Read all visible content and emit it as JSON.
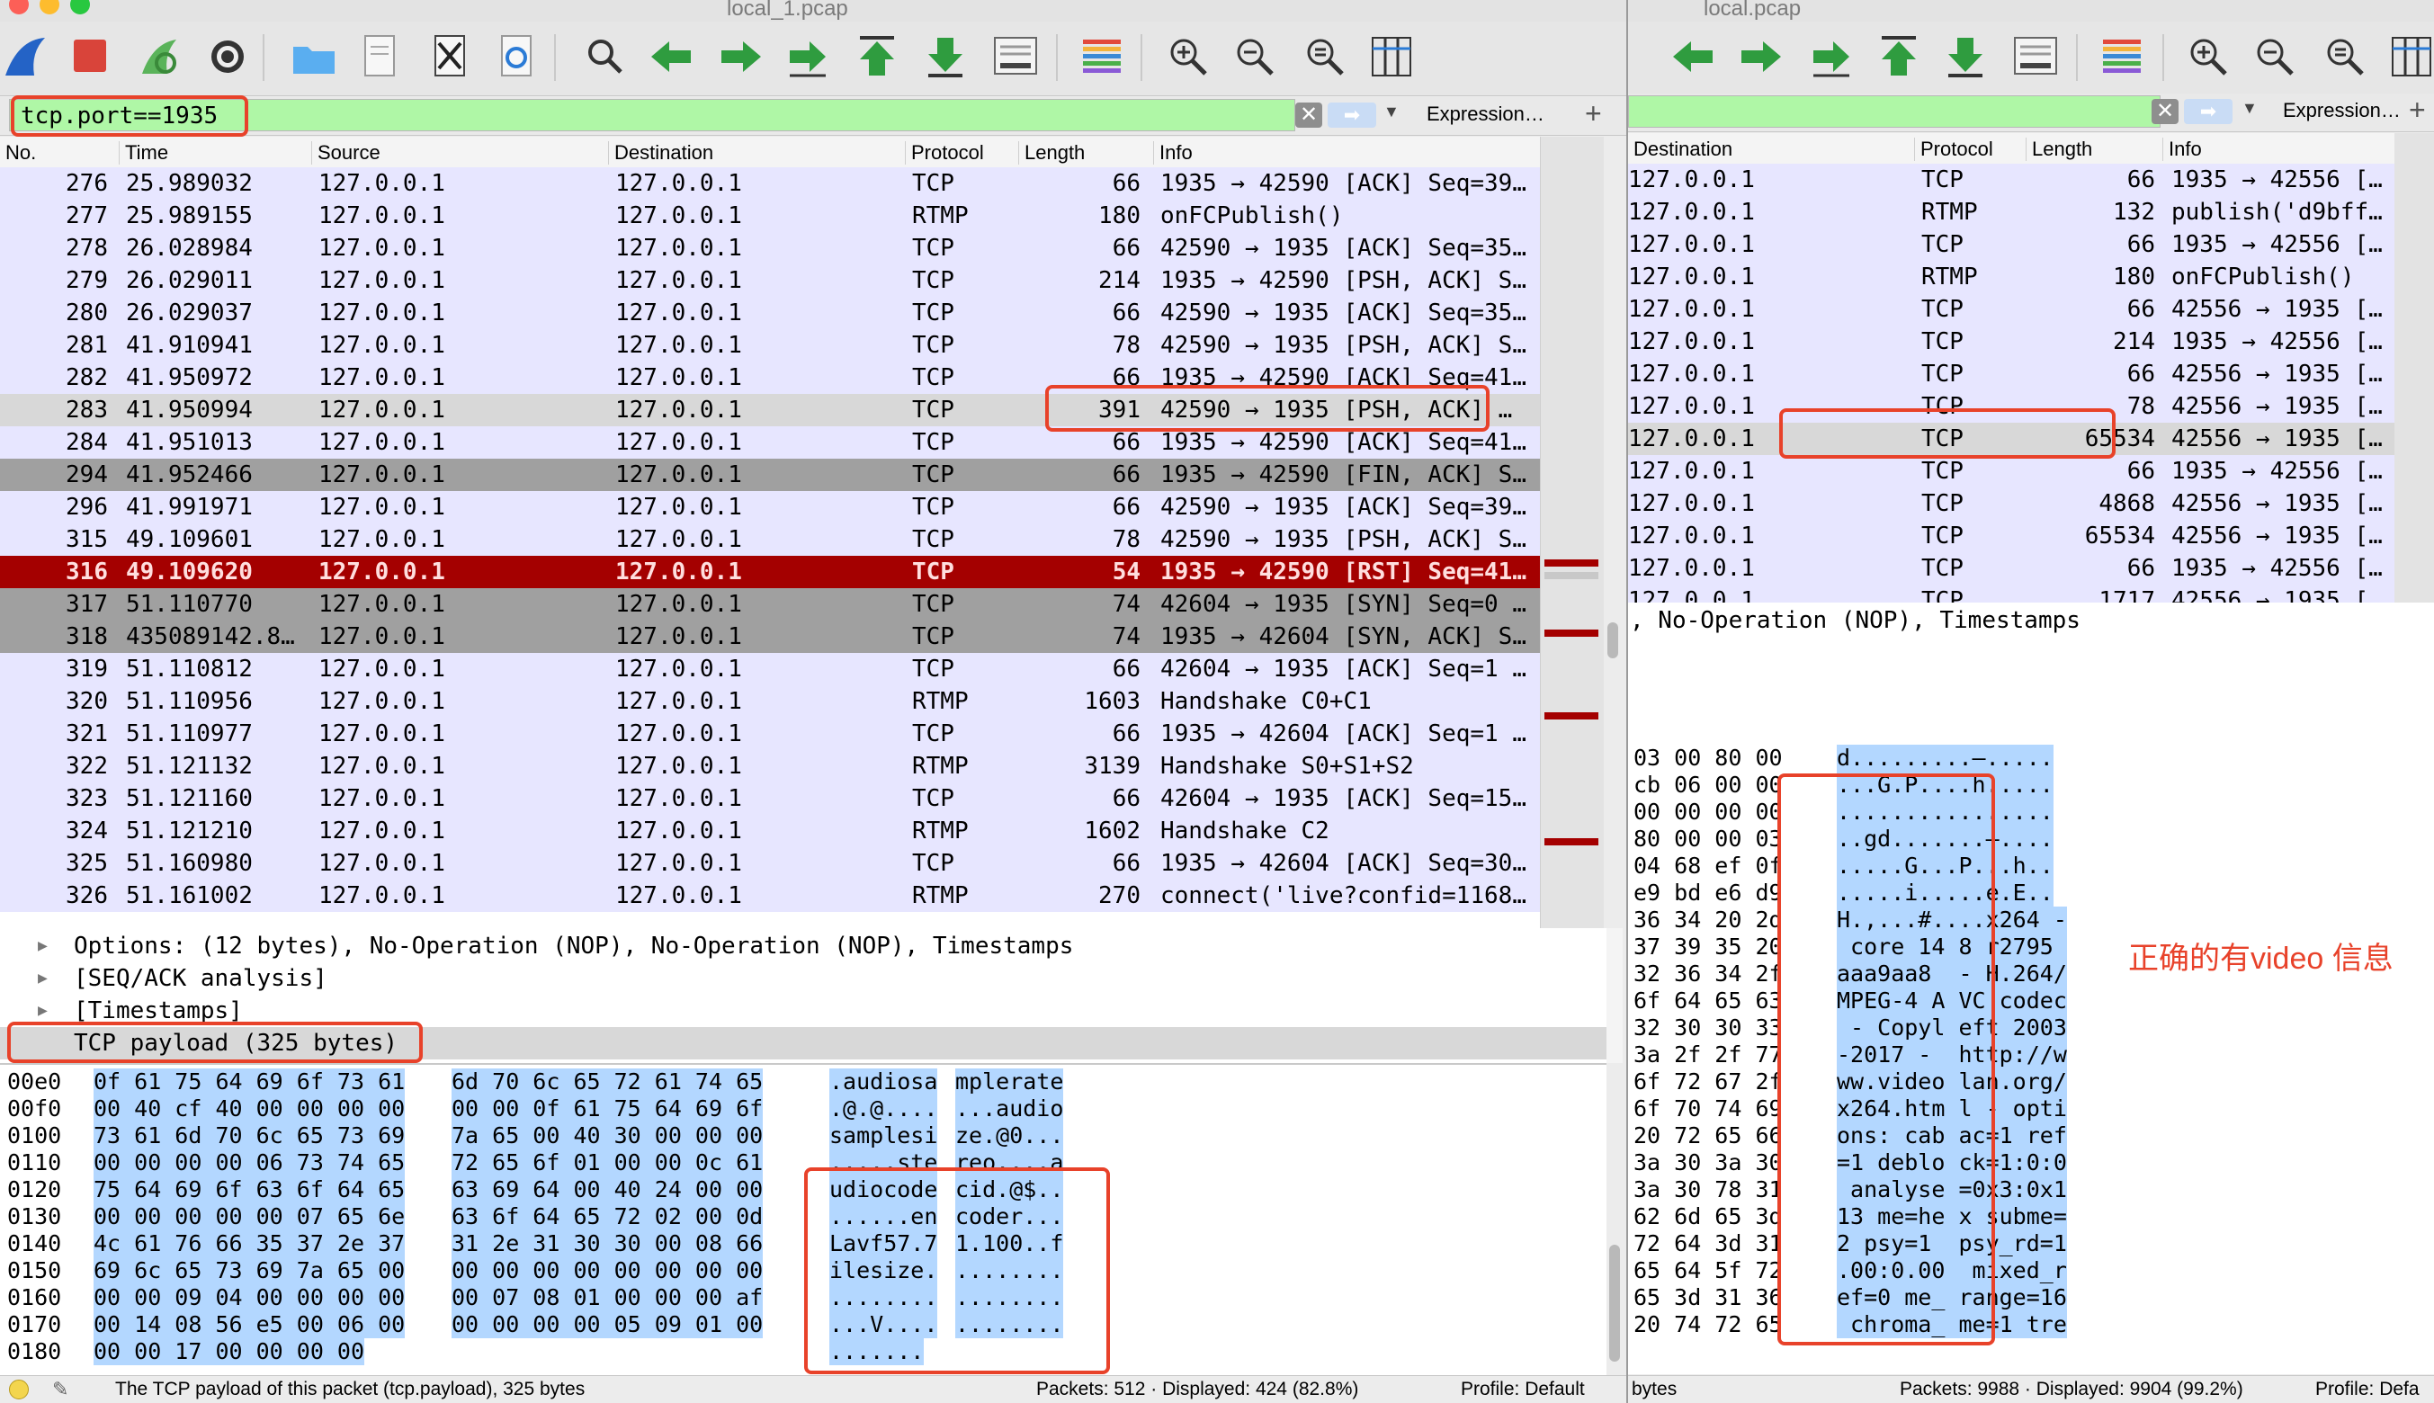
{
  "colors": {
    "filter_bg": "#aff7a6",
    "row_default": "#e7e6ff",
    "row_selected": "#d8d8d8",
    "row_gray": "#a0a0a0",
    "row_rst": "#a40000",
    "hex_selection": "#b3d7ff",
    "callout": "#e8422a"
  },
  "left": {
    "title": "local_1.pcap",
    "filter": {
      "value": "tcp.port==1935",
      "expression_label": "Expression…",
      "plus_label": "+"
    },
    "columns": [
      "No.",
      "Time",
      "Source",
      "Destination",
      "Protocol",
      "Length",
      "Info"
    ],
    "rows": [
      {
        "no": "276",
        "time": "25.989032",
        "src": "127.0.0.1",
        "dst": "127.0.0.1",
        "proto": "TCP",
        "len": "66",
        "info": "1935 → 42590 [ACK] Seq=39…",
        "style": "default"
      },
      {
        "no": "277",
        "time": "25.989155",
        "src": "127.0.0.1",
        "dst": "127.0.0.1",
        "proto": "RTMP",
        "len": "180",
        "info": "onFCPublish()",
        "style": "default"
      },
      {
        "no": "278",
        "time": "26.028984",
        "src": "127.0.0.1",
        "dst": "127.0.0.1",
        "proto": "TCP",
        "len": "66",
        "info": "42590 → 1935 [ACK] Seq=35…",
        "style": "default"
      },
      {
        "no": "279",
        "time": "26.029011",
        "src": "127.0.0.1",
        "dst": "127.0.0.1",
        "proto": "TCP",
        "len": "214",
        "info": "1935 → 42590 [PSH, ACK] S…",
        "style": "default"
      },
      {
        "no": "280",
        "time": "26.029037",
        "src": "127.0.0.1",
        "dst": "127.0.0.1",
        "proto": "TCP",
        "len": "66",
        "info": "42590 → 1935 [ACK] Seq=35…",
        "style": "default"
      },
      {
        "no": "281",
        "time": "41.910941",
        "src": "127.0.0.1",
        "dst": "127.0.0.1",
        "proto": "TCP",
        "len": "78",
        "info": "42590 → 1935 [PSH, ACK] S…",
        "style": "default"
      },
      {
        "no": "282",
        "time": "41.950972",
        "src": "127.0.0.1",
        "dst": "127.0.0.1",
        "proto": "TCP",
        "len": "66",
        "info": "1935 → 42590 [ACK] Seq=41…",
        "style": "default"
      },
      {
        "no": "283",
        "time": "41.950994",
        "src": "127.0.0.1",
        "dst": "127.0.0.1",
        "proto": "TCP",
        "len": "391",
        "info": "42590 → 1935 [PSH, ACK] …",
        "style": "selected"
      },
      {
        "no": "284",
        "time": "41.951013",
        "src": "127.0.0.1",
        "dst": "127.0.0.1",
        "proto": "TCP",
        "len": "66",
        "info": "1935 → 42590 [ACK] Seq=41…",
        "style": "default"
      },
      {
        "no": "294",
        "time": "41.952466",
        "src": "127.0.0.1",
        "dst": "127.0.0.1",
        "proto": "TCP",
        "len": "66",
        "info": "1935 → 42590 [FIN, ACK] S…",
        "style": "gray"
      },
      {
        "no": "296",
        "time": "41.991971",
        "src": "127.0.0.1",
        "dst": "127.0.0.1",
        "proto": "TCP",
        "len": "66",
        "info": "42590 → 1935 [ACK] Seq=39…",
        "style": "default"
      },
      {
        "no": "315",
        "time": "49.109601",
        "src": "127.0.0.1",
        "dst": "127.0.0.1",
        "proto": "TCP",
        "len": "78",
        "info": "42590 → 1935 [PSH, ACK] S…",
        "style": "default"
      },
      {
        "no": "316",
        "time": "49.109620",
        "src": "127.0.0.1",
        "dst": "127.0.0.1",
        "proto": "TCP",
        "len": "54",
        "info": "1935 → 42590 [RST] Seq=41…",
        "style": "rst"
      },
      {
        "no": "317",
        "time": "51.110770",
        "src": "127.0.0.1",
        "dst": "127.0.0.1",
        "proto": "TCP",
        "len": "74",
        "info": "42604 → 1935 [SYN] Seq=0 …",
        "style": "gray"
      },
      {
        "no": "318",
        "time": "435089142.8…",
        "src": "127.0.0.1",
        "dst": "127.0.0.1",
        "proto": "TCP",
        "len": "74",
        "info": "1935 → 42604 [SYN, ACK] S…",
        "style": "gray"
      },
      {
        "no": "319",
        "time": "51.110812",
        "src": "127.0.0.1",
        "dst": "127.0.0.1",
        "proto": "TCP",
        "len": "66",
        "info": "42604 → 1935 [ACK] Seq=1 …",
        "style": "default"
      },
      {
        "no": "320",
        "time": "51.110956",
        "src": "127.0.0.1",
        "dst": "127.0.0.1",
        "proto": "RTMP",
        "len": "1603",
        "info": "Handshake C0+C1",
        "style": "default"
      },
      {
        "no": "321",
        "time": "51.110977",
        "src": "127.0.0.1",
        "dst": "127.0.0.1",
        "proto": "TCP",
        "len": "66",
        "info": "1935 → 42604 [ACK] Seq=1 …",
        "style": "default"
      },
      {
        "no": "322",
        "time": "51.121132",
        "src": "127.0.0.1",
        "dst": "127.0.0.1",
        "proto": "RTMP",
        "len": "3139",
        "info": "Handshake S0+S1+S2",
        "style": "default"
      },
      {
        "no": "323",
        "time": "51.121160",
        "src": "127.0.0.1",
        "dst": "127.0.0.1",
        "proto": "TCP",
        "len": "66",
        "info": "42604 → 1935 [ACK] Seq=15…",
        "style": "default"
      },
      {
        "no": "324",
        "time": "51.121210",
        "src": "127.0.0.1",
        "dst": "127.0.0.1",
        "proto": "RTMP",
        "len": "1602",
        "info": "Handshake C2",
        "style": "default"
      },
      {
        "no": "325",
        "time": "51.160980",
        "src": "127.0.0.1",
        "dst": "127.0.0.1",
        "proto": "TCP",
        "len": "66",
        "info": "1935 → 42604 [ACK] Seq=30…",
        "style": "default"
      },
      {
        "no": "326",
        "time": "51.161002",
        "src": "127.0.0.1",
        "dst": "127.0.0.1",
        "proto": "RTMP",
        "len": "270",
        "info": "connect('live?confid=1168…",
        "style": "default"
      }
    ],
    "details": [
      {
        "text": "Options: (12 bytes), No-Operation (NOP), No-Operation (NOP), Timestamps",
        "arrow": "▶"
      },
      {
        "text": "[SEQ/ACK analysis]",
        "arrow": "▶"
      },
      {
        "text": "[Timestamps]",
        "arrow": "▶"
      },
      {
        "text": "TCP payload (325 bytes)",
        "arrow": ""
      }
    ],
    "hex": [
      {
        "off": "00e0",
        "a": "0f 61 75 64 69 6f 73 61",
        "b": "6d 70 6c 65 72 61 74 65",
        "ascii1": ".audiosa",
        "ascii2": "mplerate"
      },
      {
        "off": "00f0",
        "a": "00 40 cf 40 00 00 00 00",
        "b": "00 00 0f 61 75 64 69 6f",
        "ascii1": ".@.@....",
        "ascii2": "...audio"
      },
      {
        "off": "0100",
        "a": "73 61 6d 70 6c 65 73 69",
        "b": "7a 65 00 40 30 00 00 00",
        "ascii1": "samplesi",
        "ascii2": "ze.@0..."
      },
      {
        "off": "0110",
        "a": "00 00 00 00 06 73 74 65",
        "b": "72 65 6f 01 00 00 0c 61",
        "ascii1": ".....ste",
        "ascii2": "reo....a"
      },
      {
        "off": "0120",
        "a": "75 64 69 6f 63 6f 64 65",
        "b": "63 69 64 00 40 24 00 00",
        "ascii1": "udiocode",
        "ascii2": "cid.@$.."
      },
      {
        "off": "0130",
        "a": "00 00 00 00 00 07 65 6e",
        "b": "63 6f 64 65 72 02 00 0d",
        "ascii1": "......en",
        "ascii2": "coder..."
      },
      {
        "off": "0140",
        "a": "4c 61 76 66 35 37 2e 37",
        "b": "31 2e 31 30 30 00 08 66",
        "ascii1": "Lavf57.7",
        "ascii2": "1.100..f"
      },
      {
        "off": "0150",
        "a": "69 6c 65 73 69 7a 65 00",
        "b": "00 00 00 00 00 00 00 00",
        "ascii1": "ilesize.",
        "ascii2": "........"
      },
      {
        "off": "0160",
        "a": "00 00 09 04 00 00 00 00",
        "b": "00 07 08 01 00 00 00 af",
        "ascii1": "........",
        "ascii2": "........"
      },
      {
        "off": "0170",
        "a": "00 14 08 56 e5 00 06 00",
        "b": "00 00 00 00 05 09 01 00",
        "ascii1": "...V....",
        "ascii2": "........"
      },
      {
        "off": "0180",
        "a": "00 00 17 00 00 00 00",
        "b": "",
        "ascii1": ".......",
        "ascii2": ""
      }
    ],
    "status": {
      "hint": "The TCP payload of this packet (tcp.payload), 325 bytes",
      "packets": "Packets: 512 · Displayed: 424 (82.8%)",
      "profile": "Profile: Default"
    }
  },
  "right": {
    "title": "local.pcap",
    "filter": {
      "value": "",
      "expression_label": "Expression…",
      "plus_label": "+"
    },
    "columns": [
      "Destination",
      "Protocol",
      "Length",
      "Info"
    ],
    "rows": [
      {
        "dst": "127.0.0.1",
        "proto": "TCP",
        "len": "66",
        "info": "1935 → 42556 […",
        "style": "default"
      },
      {
        "dst": "127.0.0.1",
        "proto": "RTMP",
        "len": "132",
        "info": "publish('d9bff…",
        "style": "default"
      },
      {
        "dst": "127.0.0.1",
        "proto": "TCP",
        "len": "66",
        "info": "1935 → 42556 […",
        "style": "default"
      },
      {
        "dst": "127.0.0.1",
        "proto": "RTMP",
        "len": "180",
        "info": "onFCPublish()",
        "style": "default"
      },
      {
        "dst": "127.0.0.1",
        "proto": "TCP",
        "len": "66",
        "info": "42556 → 1935 […",
        "style": "default"
      },
      {
        "dst": "127.0.0.1",
        "proto": "TCP",
        "len": "214",
        "info": "1935 → 42556 […",
        "style": "default"
      },
      {
        "dst": "127.0.0.1",
        "proto": "TCP",
        "len": "66",
        "info": "42556 → 1935 […",
        "style": "default"
      },
      {
        "dst": "127.0.0.1",
        "proto": "TCP",
        "len": "78",
        "info": "42556 → 1935 […",
        "style": "default"
      },
      {
        "dst": "127.0.0.1",
        "proto": "TCP",
        "len": "65534",
        "info": "42556 → 1935 […",
        "style": "selected"
      },
      {
        "dst": "127.0.0.1",
        "proto": "TCP",
        "len": "66",
        "info": "1935 → 42556 […",
        "style": "default"
      },
      {
        "dst": "127.0.0.1",
        "proto": "TCP",
        "len": "4868",
        "info": "42556 → 1935 […",
        "style": "default"
      },
      {
        "dst": "127.0.0.1",
        "proto": "TCP",
        "len": "65534",
        "info": "42556 → 1935 […",
        "style": "default"
      },
      {
        "dst": "127.0.0.1",
        "proto": "TCP",
        "len": "66",
        "info": "1935 → 42556 […",
        "style": "default"
      },
      {
        "dst": "127.0.0.1",
        "proto": "TCP",
        "len": "1717",
        "info": "42556 → 1935 […",
        "style": "default"
      }
    ],
    "details": [
      {
        "text": ", No-Operation (NOP), Timestamps"
      }
    ],
    "hex": [
      {
        "a": "03 00 80 00",
        "ascii": "d.........–....."
      },
      {
        "a": "cb 06 00 00",
        "ascii": "...G.P....h....."
      },
      {
        "a": "00 00 00 00",
        "ascii": "................"
      },
      {
        "a": "80 00 00 03",
        "ascii": "..gd.......–...."
      },
      {
        "a": "04 68 ef 0f",
        "ascii": ".....G...P...h.."
      },
      {
        "a": "e9 bd e6 d9",
        "ascii": ".....i.....e.E.."
      },
      {
        "a": "36 34 20 2d",
        "ascii": "H.,...#....x264 -"
      },
      {
        "a": "37 39 35 20",
        "ascii": " core 14 8 r2795 "
      },
      {
        "a": "32 36 34 2f",
        "ascii": "aaa9aa8  - H.264/"
      },
      {
        "a": "6f 64 65 63",
        "ascii": "MPEG-4 A VC codec"
      },
      {
        "a": "32 30 30 33",
        "ascii": " - Copyl eft 2003"
      },
      {
        "a": "3a 2f 2f 77",
        "ascii": "-2017 -  http://w"
      },
      {
        "a": "6f 72 67 2f",
        "ascii": "ww.video lan.org/"
      },
      {
        "a": "6f 70 74 69",
        "ascii": "x264.htm l - opti"
      },
      {
        "a": "20 72 65 66",
        "ascii": "ons: cab ac=1 ref"
      },
      {
        "a": "3a 30 3a 30",
        "ascii": "=1 deblo ck=1:0:0"
      },
      {
        "a": "3a 30 78 31",
        "ascii": " analyse =0x3:0x1"
      },
      {
        "a": "62 6d 65 3d",
        "ascii": "13 me=he x subme="
      },
      {
        "a": "72 64 3d 31",
        "ascii": "2 psy=1  psy_rd=1"
      },
      {
        "a": "65 64 5f 72",
        "ascii": ".00:0.00  mixed_r"
      },
      {
        "a": "65 3d 31 36",
        "ascii": "ef=0 me_ range=16"
      },
      {
        "a": "20 74 72 65",
        "ascii": " chroma_ me=1 tre"
      }
    ],
    "annotation": "正确的有video 信息",
    "status": {
      "hint": "bytes",
      "packets": "Packets: 9988 · Displayed: 9904 (99.2%)",
      "profile": "Profile: Defa"
    }
  },
  "icons": [
    "shark-fin-icon",
    "stop-icon",
    "restart-icon",
    "gear-icon",
    "folder-icon",
    "document-icon",
    "close-file-icon",
    "reload-icon",
    "search-icon",
    "back-arrow-icon",
    "forward-arrow-icon",
    "go-to-packet-icon",
    "first-packet-icon",
    "last-packet-icon",
    "autoscroll-icon",
    "colorize-icon",
    "zoom-in-icon",
    "zoom-out-icon",
    "zoom-reset-icon",
    "resize-columns-icon"
  ]
}
